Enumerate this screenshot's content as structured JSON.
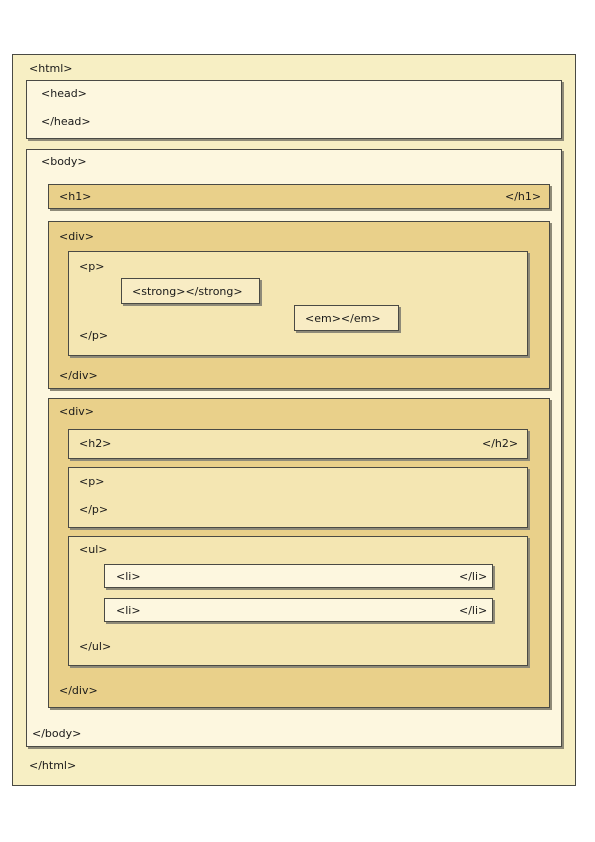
{
  "html": {
    "open": "<html>",
    "close": "</html>"
  },
  "head": {
    "open": "<head>",
    "close": "</head>"
  },
  "body": {
    "open": "<body>",
    "close": "</body>"
  },
  "h1": {
    "open": "<h1>",
    "close": "</h1>"
  },
  "div1": {
    "open": "<div>",
    "close": "</div>",
    "p": {
      "open": "<p>",
      "close": "</p>"
    },
    "strong": "<strong></strong>",
    "em": "<em></em>"
  },
  "div2": {
    "open": "<div>",
    "close": "</div>",
    "h2": {
      "open": "<h2>",
      "close": "</h2>"
    },
    "p": {
      "open": "<p>",
      "close": "</p>"
    },
    "ul": {
      "open": "<ul>",
      "close": "</ul>"
    },
    "items": [
      {
        "open": "<li>",
        "close": "</li>"
      },
      {
        "open": "<li>",
        "close": "</li>"
      }
    ]
  },
  "colors": {
    "html_bg": "#f7efc4",
    "head_body_bg": "#fdf7df",
    "h1_div_bg": "#e9d08a",
    "inner_bg": "#f4e6b2",
    "border": "#4a4a44"
  }
}
